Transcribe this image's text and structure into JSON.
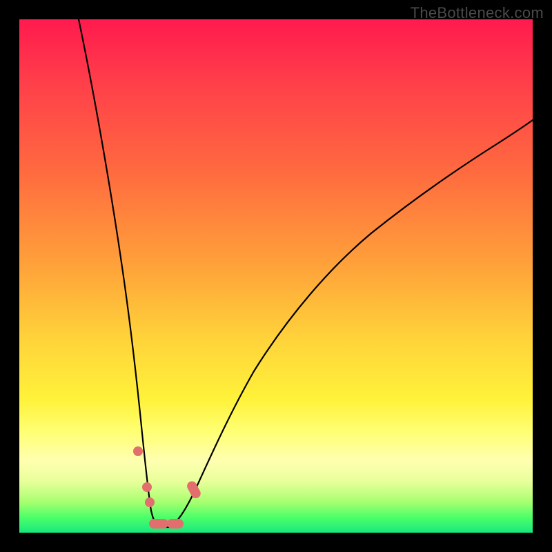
{
  "watermark": "TheBottleneck.com",
  "colors": {
    "frame": "#000000",
    "gradient_top": "#ff1a4e",
    "gradient_bottom": "#18e87e",
    "curve": "#000000",
    "marker": "#e36e6e"
  },
  "chart_data": {
    "type": "line",
    "title": "",
    "xlabel": "",
    "ylabel": "",
    "xlim": [
      0,
      100
    ],
    "ylim": [
      0,
      100
    ],
    "note": "Axes have no tick labels; values below are estimated from pixel positions relative to the plot area (0–100 scale, y=0 at bottom).",
    "series": [
      {
        "name": "left-branch",
        "x": [
          12,
          14,
          16,
          18,
          20,
          22,
          23,
          24,
          24.5,
          25,
          25.5,
          26,
          27,
          28
        ],
        "y": [
          100,
          85,
          70,
          55,
          40,
          25,
          17,
          10,
          6,
          4,
          2.5,
          2,
          2,
          2
        ]
      },
      {
        "name": "right-branch",
        "x": [
          28,
          30,
          32,
          34,
          36,
          40,
          45,
          50,
          55,
          60,
          65,
          70,
          75,
          80,
          85,
          90,
          95,
          100
        ],
        "y": [
          2,
          2.5,
          5,
          9,
          14,
          24,
          34,
          42,
          49,
          55,
          60,
          64,
          68,
          71,
          74.5,
          77.5,
          80,
          82
        ]
      }
    ],
    "markers": [
      {
        "shape": "dot",
        "x": 22.5,
        "y": 16
      },
      {
        "shape": "dot",
        "x": 24.3,
        "y": 9
      },
      {
        "shape": "dot",
        "x": 24.8,
        "y": 6
      },
      {
        "shape": "pill",
        "x": 26.0,
        "y": 2.3,
        "len": 3.2
      },
      {
        "shape": "pill",
        "x": 29.5,
        "y": 2.3,
        "len": 2.8
      },
      {
        "shape": "pill",
        "x": 33.5,
        "y": 8.5,
        "len": 2.6,
        "angle": 62
      }
    ]
  }
}
